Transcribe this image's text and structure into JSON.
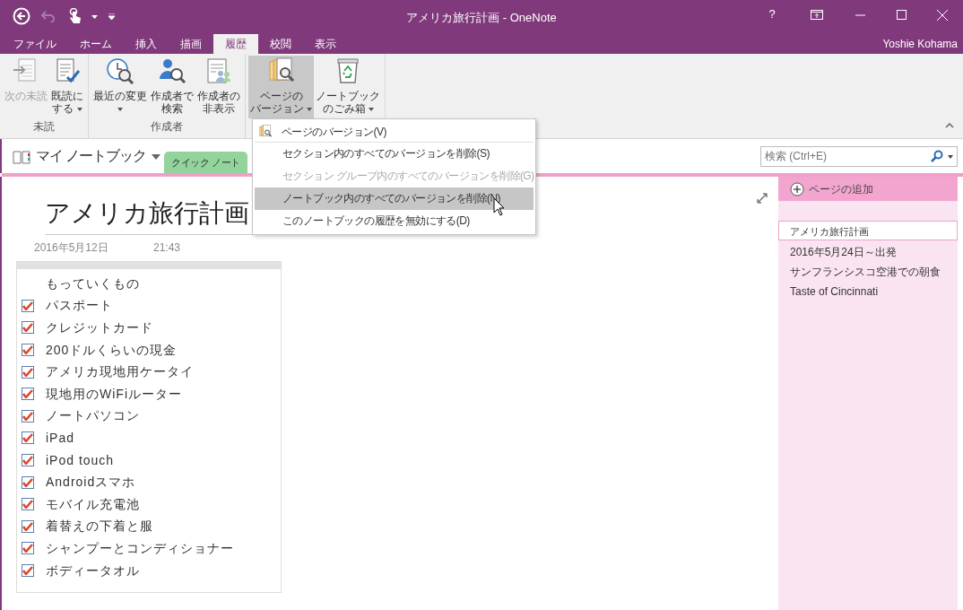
{
  "window": {
    "title": "アメリカ旅行計画 - OneNote",
    "help": "?"
  },
  "ribbon_tabs": [
    {
      "label": "ファイル",
      "selected": false
    },
    {
      "label": "ホーム",
      "selected": false
    },
    {
      "label": "挿入",
      "selected": false
    },
    {
      "label": "描画",
      "selected": false
    },
    {
      "label": "履歴",
      "selected": true
    },
    {
      "label": "校閲",
      "selected": false
    },
    {
      "label": "表示",
      "selected": false
    }
  ],
  "user": "Yoshie Kohama",
  "ribbon_groups": [
    {
      "label": "未読",
      "buttons": [
        {
          "kind": "next",
          "lines": [
            "次の未読"
          ],
          "disabled": true,
          "dropdown": false,
          "pressed": false
        },
        {
          "kind": "markread",
          "lines": [
            "既読に",
            "する"
          ],
          "disabled": false,
          "dropdown": true,
          "pressed": false
        }
      ]
    },
    {
      "label": "作成者",
      "buttons": [
        {
          "kind": "recent",
          "lines": [
            "最近の変更"
          ],
          "disabled": false,
          "dropdown": true,
          "pressed": false
        },
        {
          "kind": "find",
          "lines": [
            "作成者で",
            "検索"
          ],
          "disabled": false,
          "dropdown": false,
          "pressed": false
        },
        {
          "kind": "hide",
          "lines": [
            "作成者の",
            "非表示"
          ],
          "disabled": false,
          "dropdown": false,
          "pressed": false
        }
      ]
    },
    {
      "buttons": [
        {
          "kind": "versions",
          "lines": [
            "ページの",
            "バージョン"
          ],
          "disabled": false,
          "dropdown": true,
          "pressed": true
        },
        {
          "kind": "recycle",
          "lines": [
            "ノートブック",
            "のごみ箱"
          ],
          "disabled": false,
          "dropdown": true,
          "pressed": false
        }
      ]
    }
  ],
  "version_menu": [
    {
      "kind": "header",
      "label": "ページのバージョン(V)"
    },
    {
      "kind": "item",
      "label": "セクション内のすべてのバージョンを削除(S)",
      "disabled": false,
      "highlighted": false
    },
    {
      "kind": "item",
      "label": "セクション グループ内のすべてのバージョンを削除(G)",
      "disabled": true,
      "highlighted": false
    },
    {
      "kind": "item",
      "label": "ノートブック内のすべてのバージョンを削除(N)",
      "disabled": false,
      "highlighted": true
    },
    {
      "kind": "item",
      "label": "このノートブックの履歴を無効にする(D)",
      "disabled": false,
      "highlighted": false
    }
  ],
  "notebook": {
    "name": "マイ ノートブック"
  },
  "sections": [
    {
      "label": "クイック ノート",
      "selected": true
    }
  ],
  "search": {
    "placeholder": "検索 (Ctrl+E)"
  },
  "page": {
    "title": "アメリカ旅行計画",
    "date": "2016年5月12日",
    "time": "21:43",
    "outline": [
      {
        "kind": "text",
        "text": "もっていくもの"
      },
      {
        "kind": "todo",
        "text": "パスポート",
        "checked": true
      },
      {
        "kind": "todo",
        "text": "クレジットカード",
        "checked": true
      },
      {
        "kind": "todo",
        "text": "200ドルくらいの現金",
        "checked": true
      },
      {
        "kind": "todo",
        "text": "アメリカ現地用ケータイ",
        "checked": true
      },
      {
        "kind": "todo",
        "text": "現地用のWiFiルーター",
        "checked": true
      },
      {
        "kind": "todo",
        "text": "ノートパソコン",
        "checked": true
      },
      {
        "kind": "todo",
        "text": "iPad",
        "checked": true
      },
      {
        "kind": "todo",
        "text": "iPod touch",
        "checked": true
      },
      {
        "kind": "todo",
        "text": "Androidスマホ",
        "checked": true
      },
      {
        "kind": "todo",
        "text": "モバイル充電池",
        "checked": true
      },
      {
        "kind": "todo",
        "text": "着替えの下着と服",
        "checked": true
      },
      {
        "kind": "todo",
        "text": "シャンプーとコンディショナー",
        "checked": true
      },
      {
        "kind": "todo",
        "text": "ボディータオル",
        "checked": true
      }
    ]
  },
  "page_list": {
    "add_label": "ページの追加",
    "pages": [
      {
        "title": "アメリカ旅行計画",
        "selected": true
      },
      {
        "title": "2016年5月24日～出発",
        "selected": false
      },
      {
        "title": "サンフランシスコ空港での朝食",
        "selected": false
      },
      {
        "title": "Taste of Cincinnati",
        "selected": false
      }
    ]
  }
}
